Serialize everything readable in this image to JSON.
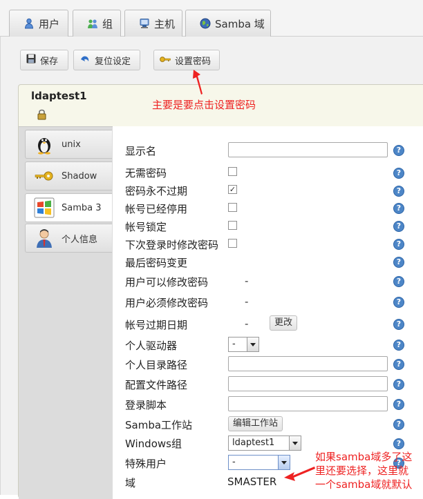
{
  "top_tabs": [
    {
      "label": "用户"
    },
    {
      "label": "组"
    },
    {
      "label": "主机"
    },
    {
      "label": "Samba 域"
    }
  ],
  "toolbar": {
    "save_label": "保存",
    "reset_label": "复位设定",
    "set_password_label": "设置密码"
  },
  "account": {
    "name": "ldaptest1"
  },
  "side_tabs": [
    {
      "label": "unix"
    },
    {
      "label": "Shadow"
    },
    {
      "label": "Samba 3"
    },
    {
      "label": "个人信息"
    }
  ],
  "form": {
    "display_name_label": "显示名",
    "no_password_label": "无需密码",
    "password_never_expires_label": "密码永不过期",
    "account_disabled_label": "帐号已经停用",
    "account_locked_label": "帐号锁定",
    "change_password_next_login_label": "下次登录时修改密码",
    "last_password_change_label": "最后密码变更",
    "user_can_change_password_label": "用户可以修改密码",
    "user_can_change_password_value": "-",
    "user_must_change_password_label": "用户必须修改密码",
    "user_must_change_password_value": "-",
    "account_expiry_label": "帐号过期日期",
    "account_expiry_value": "-",
    "change_button_label": "更改",
    "home_drive_label": "个人驱动器",
    "home_drive_value": "-",
    "home_path_label": "个人目录路径",
    "profile_path_label": "配置文件路径",
    "logon_script_label": "登录脚本",
    "workstations_label": "Samba工作站",
    "edit_workstations_label": "编辑工作站",
    "windows_group_label": "Windows组",
    "windows_group_value": "ldaptest1",
    "special_user_label": "特殊用户",
    "special_user_value": "-",
    "domain_label": "域",
    "domain_value": "SMASTER"
  },
  "checkboxes": {
    "no_password": false,
    "password_never_expires": true,
    "account_disabled": false,
    "account_locked": false,
    "change_password_next_login": false
  },
  "annotations": {
    "set_password_note": "主要是要点击设置密码",
    "domain_note_line1": "如果samba域多了这",
    "domain_note_line2": "里还要选择，这里就",
    "domain_note_line3": "一个samba域就默认"
  },
  "colors": {
    "annotation_red": "#ee2222",
    "help_blue": "#4d86c7"
  }
}
